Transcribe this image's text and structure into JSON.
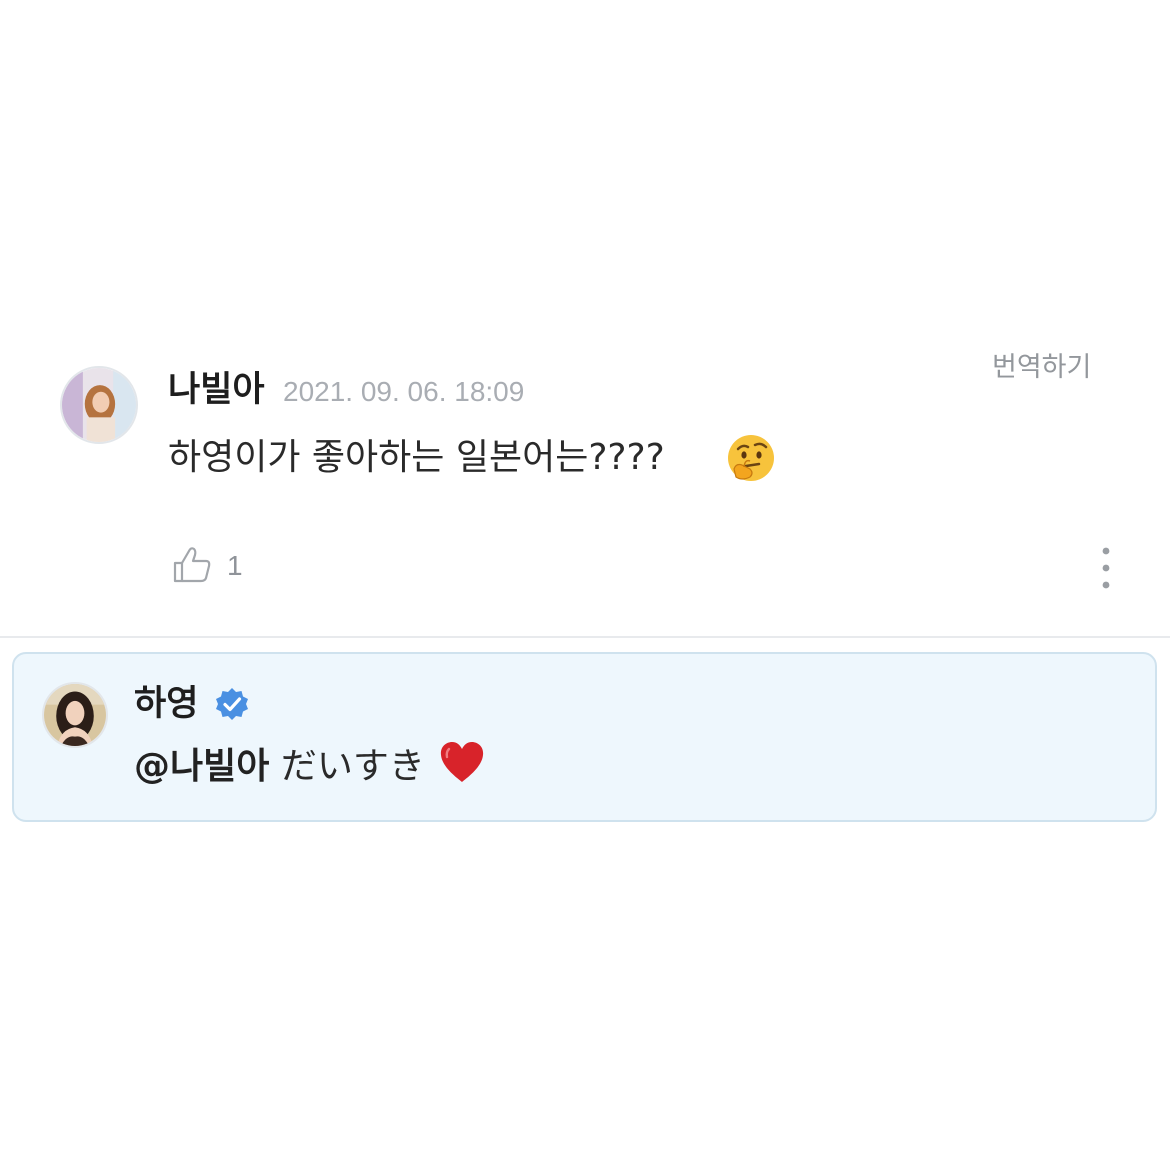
{
  "comment": {
    "author": "나빌아",
    "date": "2021. 09. 06. 18:09",
    "translate_label": "번역하기",
    "text": "하영이가 좋아하는 일본어는????",
    "emoji": "thinking-face-emoji",
    "like_icon": "thumbs-up-icon",
    "like_count": "1",
    "more_icon": "more-vertical-icon"
  },
  "reply": {
    "author": "하영",
    "verified_icon": "verified-badge-icon",
    "mention": "@나빌아",
    "text": "だいすき",
    "emoji": "red-heart-emoji",
    "background": "#eef7fd",
    "border": "#cfe2ee"
  },
  "colors": {
    "verified": "#4a90e2",
    "secondary_text": "#a9adb3",
    "primary_text": "#222222"
  }
}
